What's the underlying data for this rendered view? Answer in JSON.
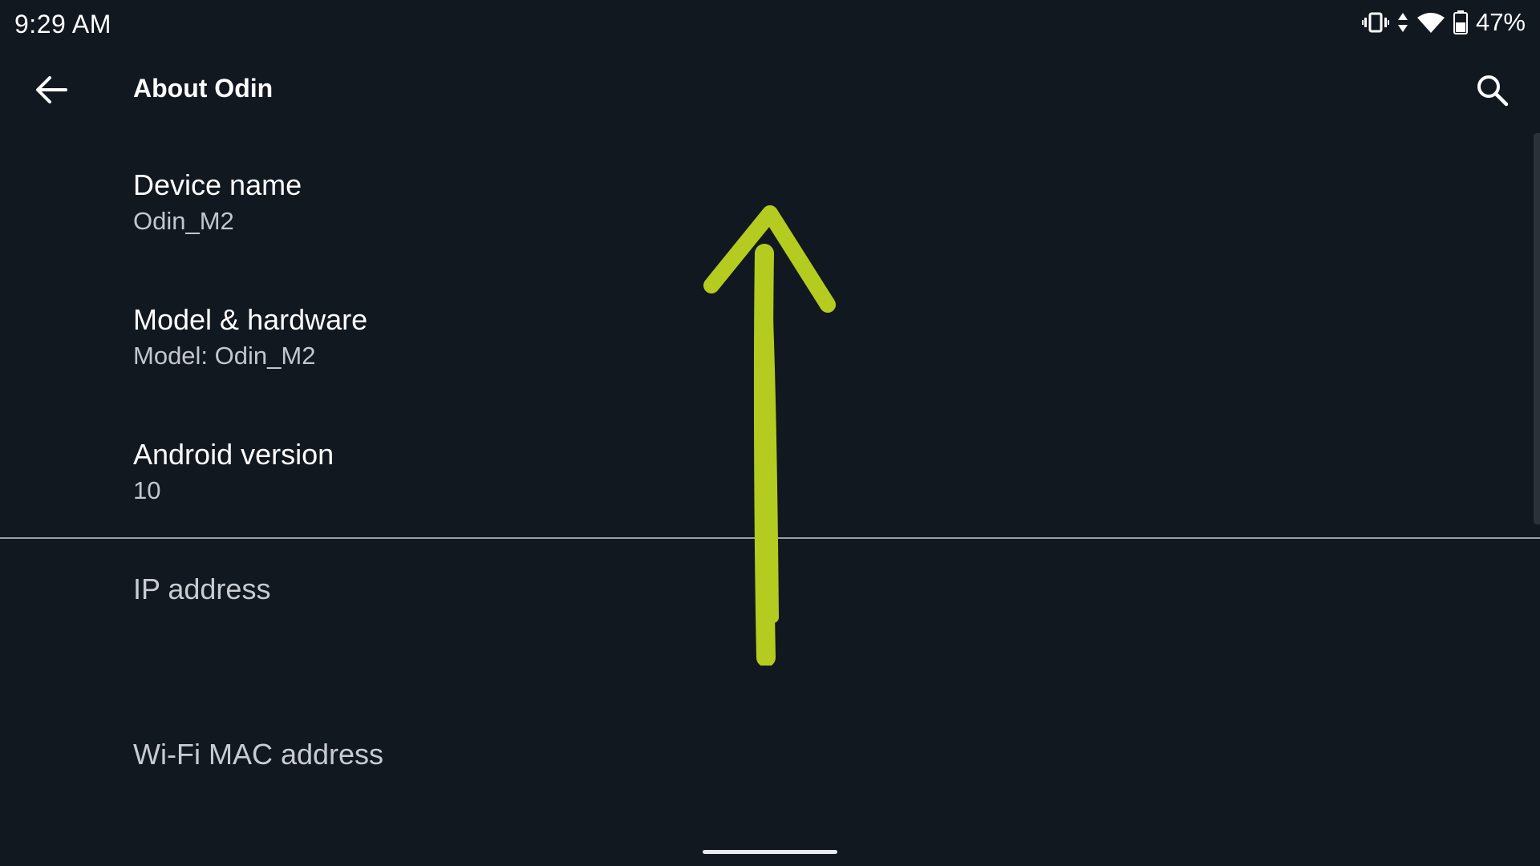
{
  "status_bar": {
    "time": "9:29 AM",
    "battery_percent": "47%",
    "icons": [
      "vibrate-icon",
      "data-transfer-icon",
      "wifi-6-icon",
      "battery-icon"
    ]
  },
  "app_bar": {
    "title": "About Odin",
    "back_icon": "arrow-back-icon",
    "search_icon": "search-icon"
  },
  "items": [
    {
      "title": "Device name",
      "summary": "Odin_M2"
    },
    {
      "title": "Model & hardware",
      "summary": "Model: Odin_M2"
    },
    {
      "title": "Android version",
      "summary": "10"
    },
    {
      "title": "IP address"
    },
    {
      "title": "Wi-Fi MAC address"
    }
  ],
  "annotation": {
    "type": "swipe-up-arrow",
    "color": "#b3cc1f"
  },
  "colors": {
    "background": "#121820",
    "text_primary": "#ffffff",
    "text_secondary": "#c3c7cc",
    "divider": "#9aa0a6"
  }
}
